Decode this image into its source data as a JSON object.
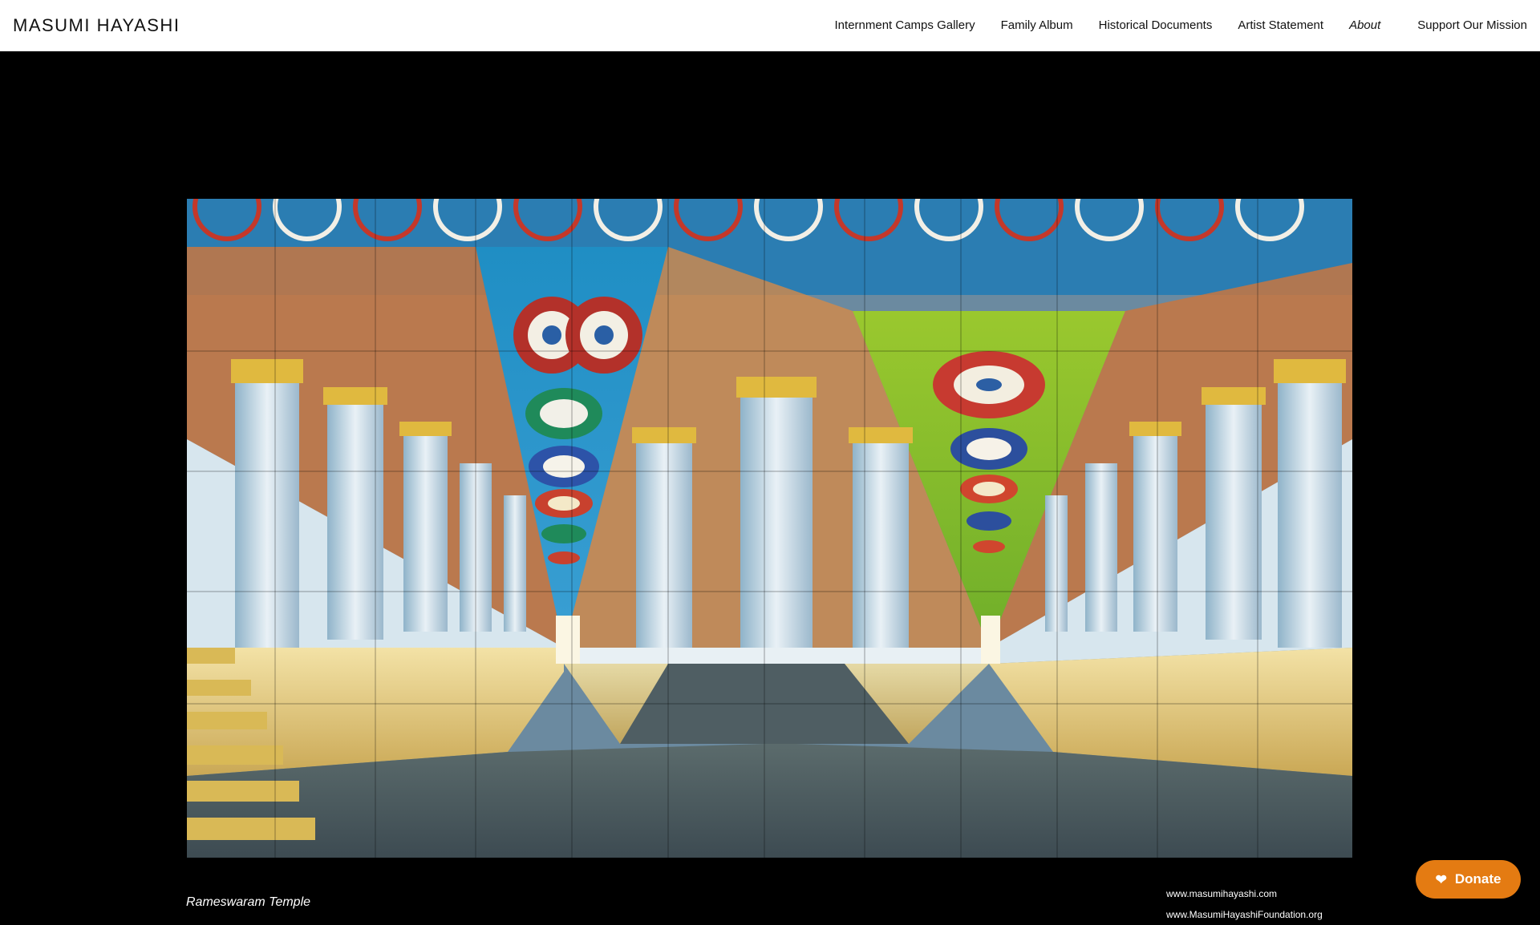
{
  "site": {
    "title": "MASUMI HAYASHI"
  },
  "nav": {
    "items": [
      {
        "label": "Internment Camps Gallery"
      },
      {
        "label": "Family Album"
      },
      {
        "label": "Historical Documents"
      },
      {
        "label": "Artist Statement"
      },
      {
        "label": "About",
        "active": true
      }
    ],
    "support_label": "Support Our Mission"
  },
  "artwork": {
    "caption": "Rameswaram Temple"
  },
  "footer_links": [
    "www.masumihayashi.com",
    "www.MasumiHayashiFoundation.org"
  ],
  "donate": {
    "label": "Donate",
    "icon": "heart-icon",
    "color": "#e47b12"
  }
}
